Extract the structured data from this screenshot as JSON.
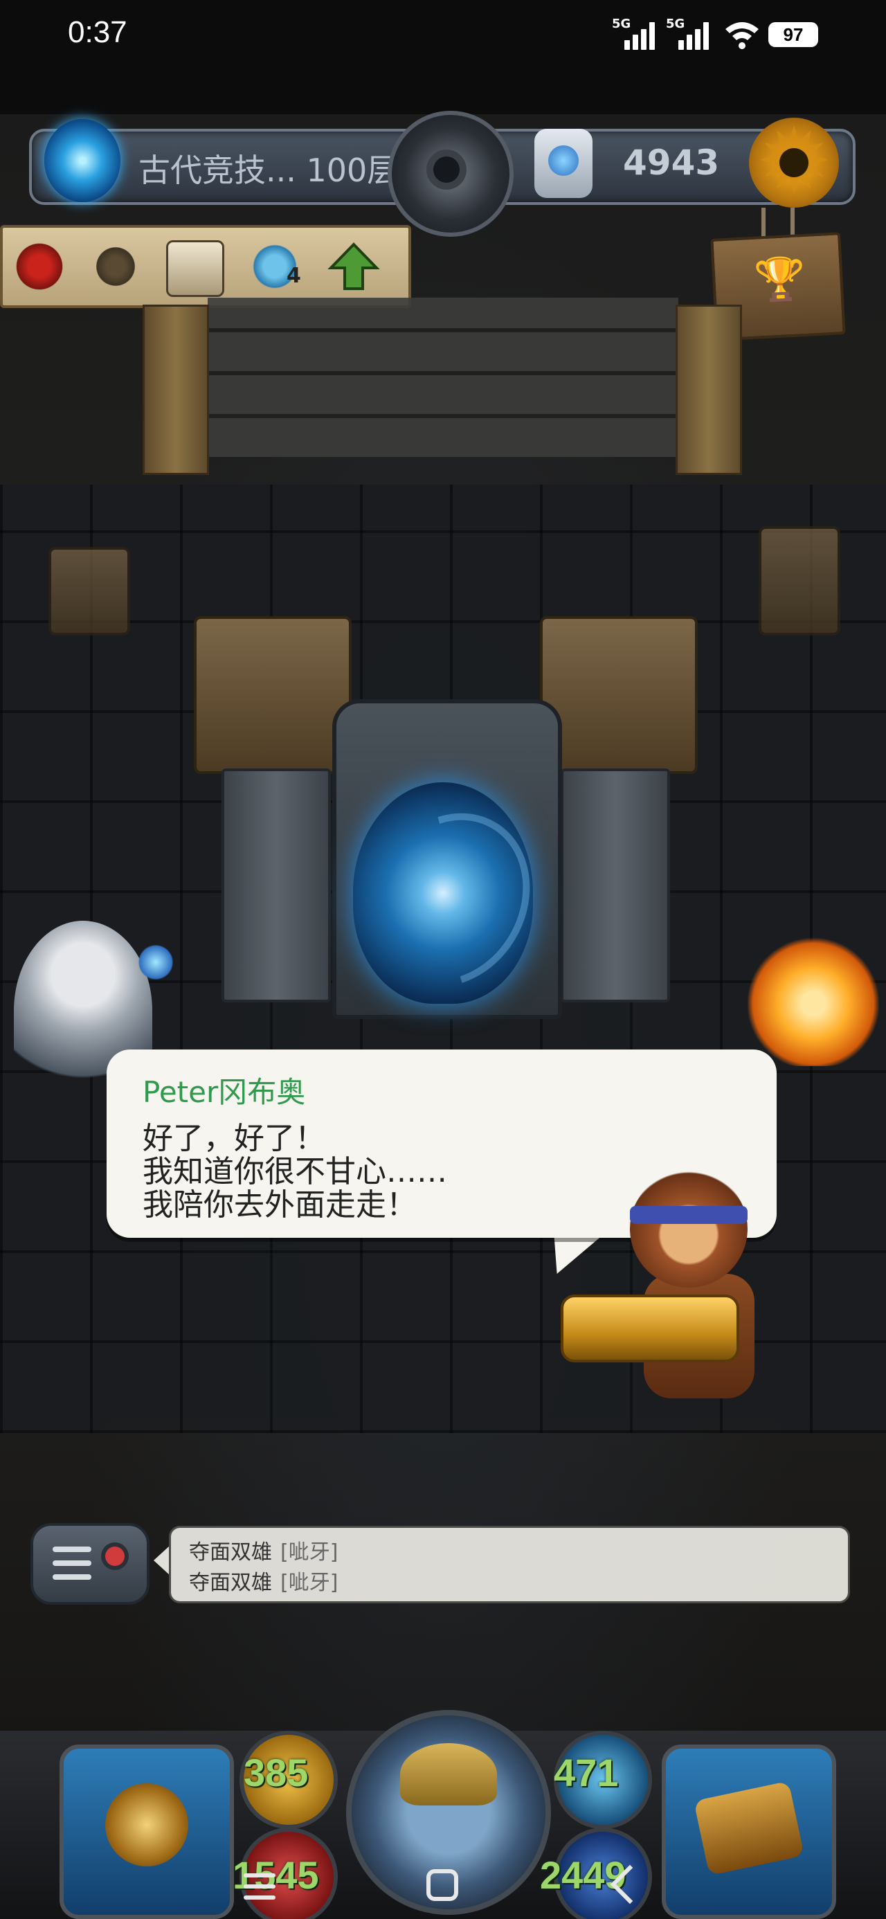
{
  "status_bar": {
    "time": "0:37",
    "network_1": "5G",
    "network_2": "5G",
    "battery": "97"
  },
  "top_bar": {
    "location_label": "古代竞技... 100层",
    "gem_count": "4943"
  },
  "toolbar": {
    "items": [
      "blood-splat-icon",
      "candelabra-icon",
      "map-scroll-icon",
      "ghost-companion-icon",
      "up-arrow-icon"
    ],
    "companion_badge": "4"
  },
  "dialog": {
    "speaker": "Peter冈布奥",
    "lines": [
      "好了，好了！",
      "我知道你很不甘心……",
      "我陪你去外面走走！"
    ]
  },
  "chat": {
    "messages": [
      {
        "name": "夺面双雄",
        "emote": "[呲牙]"
      },
      {
        "name": "夺面双雄",
        "emote": "[呲牙]"
      }
    ]
  },
  "hud": {
    "stat_top_left": "385",
    "stat_top_right": "471",
    "stat_bottom_left": "1545",
    "stat_bottom_right": "2449"
  },
  "colors": {
    "speaker_name": "#2f9a4c",
    "stat_text": "#9dd76a",
    "portal": "#2a8ad8",
    "settings_gear": "#d68e12"
  }
}
